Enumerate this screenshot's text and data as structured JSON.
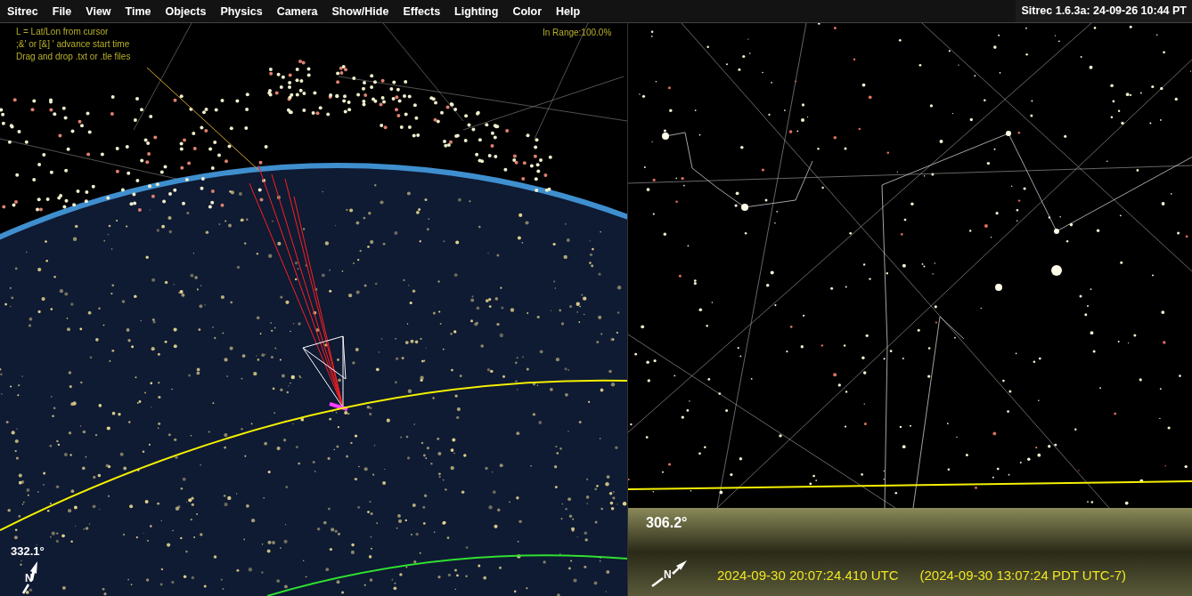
{
  "menu": {
    "items": [
      "Sitrec",
      "File",
      "View",
      "Time",
      "Objects",
      "Physics",
      "Camera",
      "Show/Hide",
      "Effects",
      "Lighting",
      "Color",
      "Help"
    ]
  },
  "version": "Sitrec 1.6.3a: 24-09-26 10:44 PT",
  "earth_view": {
    "help_lines": [
      "L = Lat/Lon from cursor",
      ";&' or [&] ' advance start time",
      "Drag and drop .txt or .tle files"
    ],
    "in_range": "In Range:100.0%",
    "heading": "332.1°",
    "compass_label": "N"
  },
  "sky_view": {
    "heading": "306.2°",
    "compass_label": "N",
    "utc_time": "2024-09-30 20:07:24.410 UTC",
    "local_time": "(2024-09-30 13:07:24 PDT UTC-7)"
  }
}
